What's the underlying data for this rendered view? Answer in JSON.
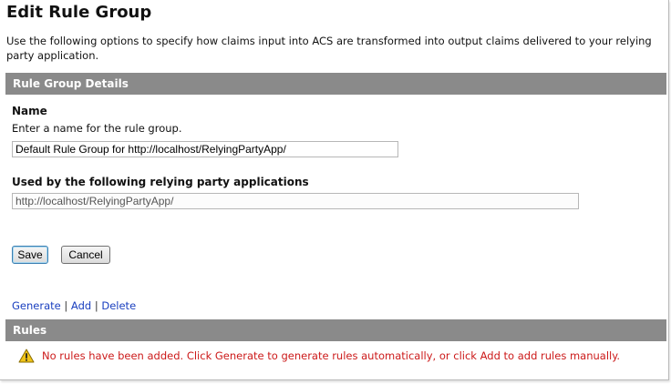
{
  "page": {
    "title": "Edit Rule Group",
    "description": "Use the following options to specify how claims input into ACS are transformed into output claims delivered to your relying party application."
  },
  "details_section": {
    "header": "Rule Group Details",
    "name_label": "Name",
    "name_help": "Enter a name for the rule group.",
    "name_value": "Default Rule Group for http://localhost/RelyingPartyApp/",
    "used_by_label": "Used by the following relying party applications",
    "used_by_value": "http://localhost/RelyingPartyApp/"
  },
  "buttons": {
    "save": "Save",
    "cancel": "Cancel"
  },
  "actions": {
    "generate": "Generate",
    "add": "Add",
    "delete": "Delete",
    "separator": "|"
  },
  "rules_section": {
    "header": "Rules",
    "warning_icon": "warning-icon",
    "warning": "No rules have been added. Click Generate to generate rules automatically, or click Add to add rules manually."
  },
  "colors": {
    "section_header_bg": "#8a8a8a",
    "link": "#1a3fbf",
    "warning_text": "#cc1a1a",
    "warning_icon": "#f0c419"
  }
}
